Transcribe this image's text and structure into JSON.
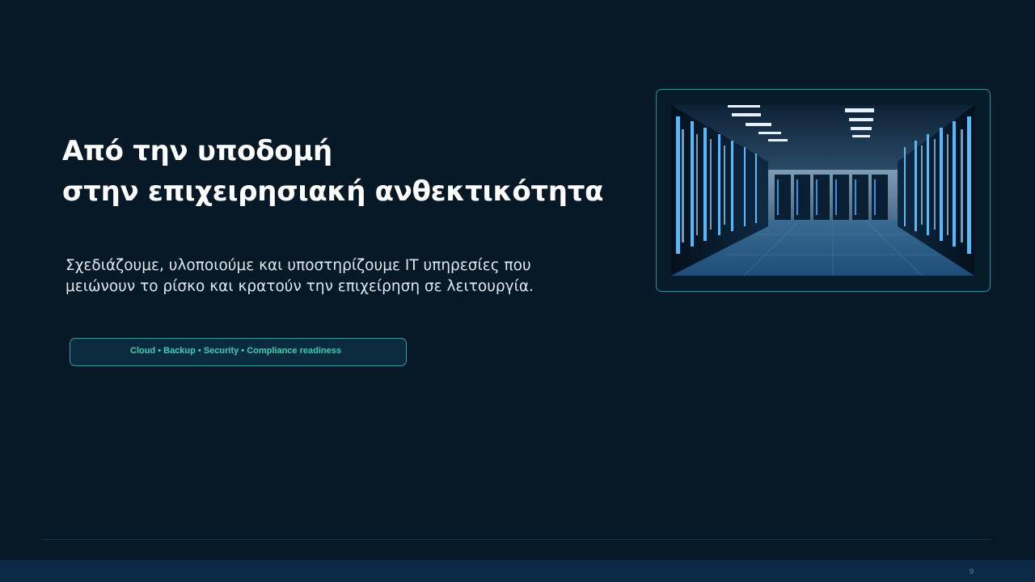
{
  "slide": {
    "title_line_1": "Από την υποδομή",
    "title_line_2": "στην επιχειρησιακή ανθεκτικότητα",
    "subtitle_line_1": "Σχεδιάζουμε, υλοποιούμε και υποστηρίζουμε IT υπηρεσίες που",
    "subtitle_line_2": "μειώνουν το ρίσκο και κρατούν την επιχείρηση σε λειτουργία.",
    "tags_text": "Cloud • Backup • Security • Compliance readiness",
    "page_number": "9"
  },
  "image": {
    "subject": "server-room-photo"
  },
  "colors": {
    "background": "#071827",
    "accent_teal": "#39d0b5",
    "frame_border": "#2f8fa6",
    "footer_bar": "#0b2a45"
  }
}
